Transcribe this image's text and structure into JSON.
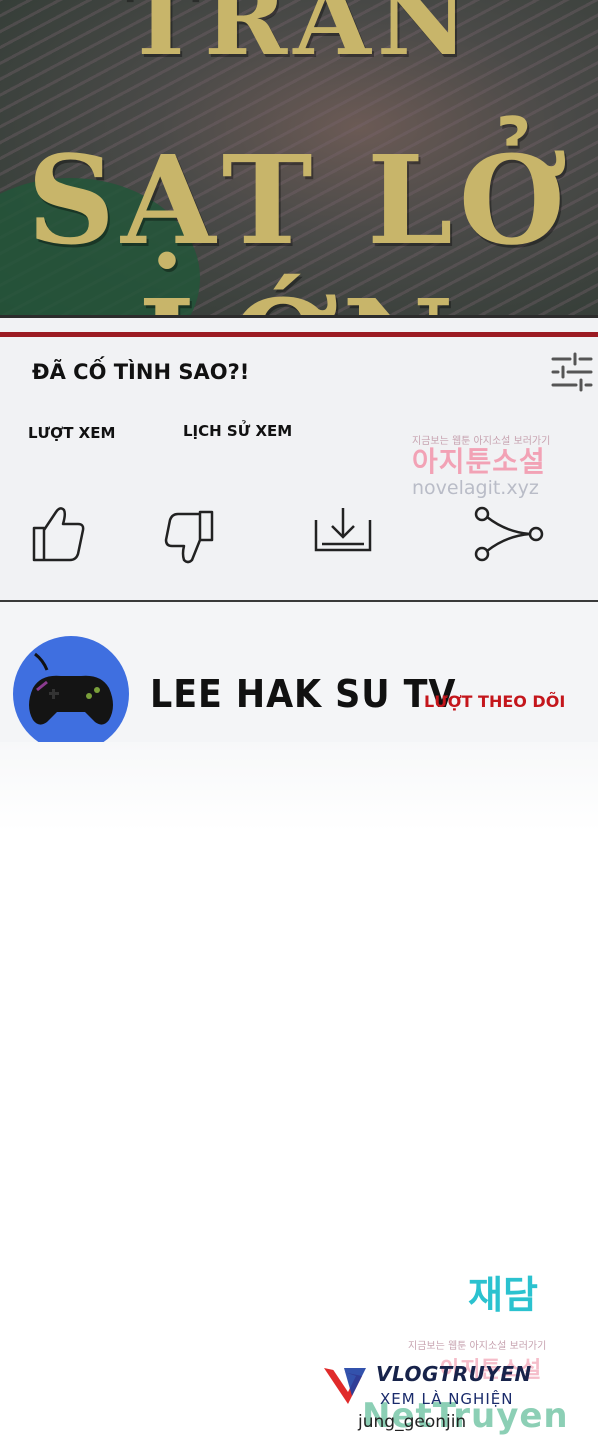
{
  "banner": {
    "line1": "TRẦN",
    "line2": "SẠT LỞ LỚN",
    "text_color": "#c8b56a"
  },
  "video": {
    "title": "ĐÃ CỐ TÌNH SAO?!",
    "views_label": "LƯỢT XEM",
    "history_label": "LỊCH SỬ XEM",
    "accent_color": "#9b1b22",
    "icons": [
      "thumbs-up-icon",
      "thumbs-down-icon",
      "download-icon",
      "share-icon",
      "filter-sliders-icon"
    ]
  },
  "watermark_top": {
    "small": "지금보는 웹툰 아지소설 보러가기",
    "big": "아지툰소설",
    "url": "novelagit.xyz"
  },
  "channel": {
    "name": "LEE HAK SU TV",
    "follow_label": "LƯỢT THEO DÕI",
    "avatar_icon": "gamepad-icon",
    "avatar_color": "#3f6fe0"
  },
  "footer": {
    "kr_logo": "재담",
    "kr_watermark": "지금보는 웹툰 아지소설 보러가기",
    "kr_watermark_big": "아지툰소설",
    "vlog_name": "VLOGTRUYEN",
    "vlog_sub": "XEM LÀ NGHIỆN",
    "credit": "jung_geonjin",
    "site": "NetTruyen"
  }
}
